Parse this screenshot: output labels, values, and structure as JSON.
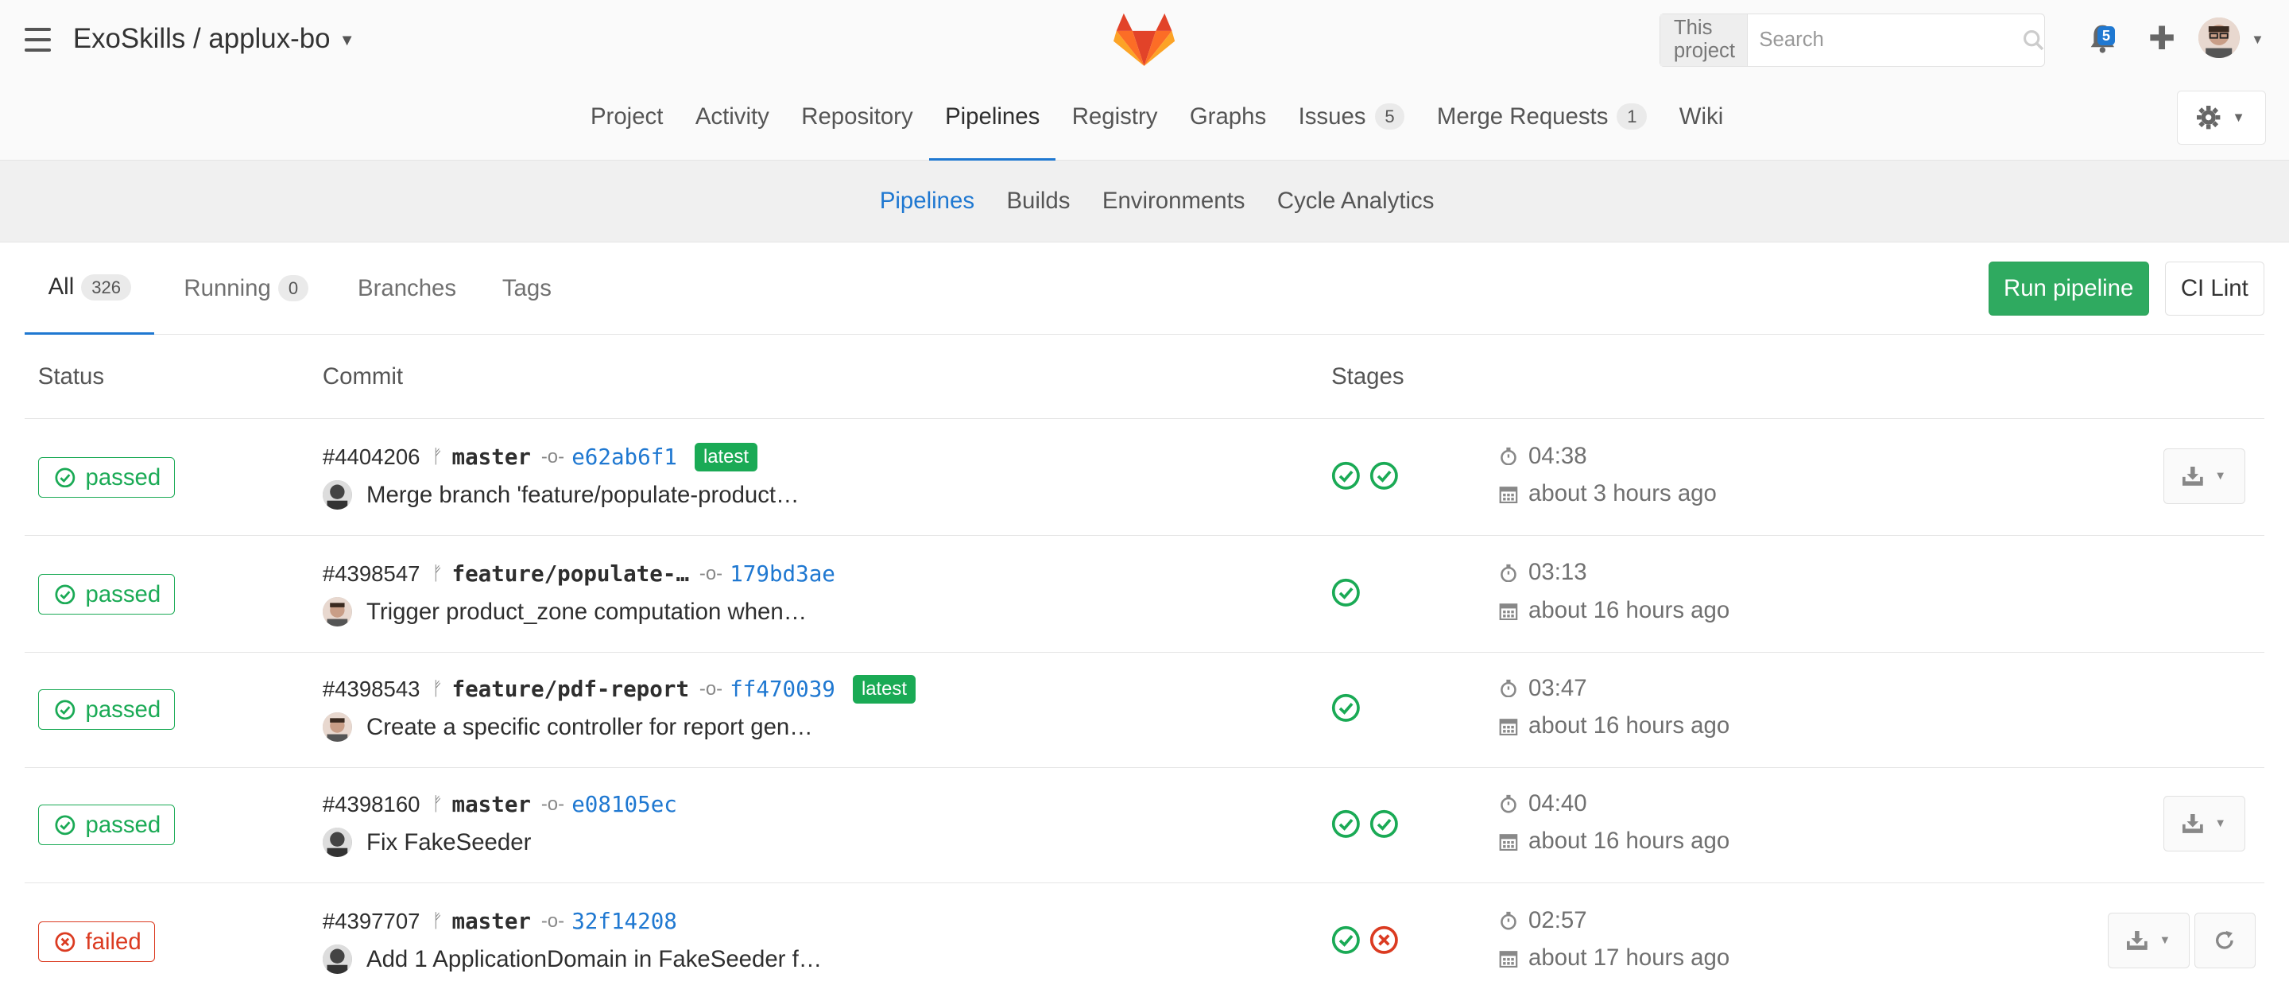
{
  "header": {
    "project_title": "ExoSkills / applux-bo",
    "search_scope": "This project",
    "search_placeholder": "Search",
    "notifications_count": "5"
  },
  "nav": {
    "items": [
      {
        "label": "Project"
      },
      {
        "label": "Activity"
      },
      {
        "label": "Repository"
      },
      {
        "label": "Pipelines"
      },
      {
        "label": "Registry"
      },
      {
        "label": "Graphs"
      },
      {
        "label": "Issues",
        "count": "5"
      },
      {
        "label": "Merge Requests",
        "count": "1"
      },
      {
        "label": "Wiki"
      }
    ],
    "active": "Pipelines"
  },
  "subnav": {
    "items": [
      "Pipelines",
      "Builds",
      "Environments",
      "Cycle Analytics"
    ],
    "active": "Pipelines"
  },
  "tabs": {
    "all": {
      "label": "All",
      "count": "326"
    },
    "running": {
      "label": "Running",
      "count": "0"
    },
    "branches": {
      "label": "Branches"
    },
    "tags": {
      "label": "Tags"
    },
    "run_pipeline": "Run pipeline",
    "ci_lint": "CI Lint"
  },
  "table": {
    "headers": {
      "status": "Status",
      "commit": "Commit",
      "stages": "Stages"
    },
    "rows": [
      {
        "status": "passed",
        "id": "#4404206",
        "branch": "master",
        "sha": "e62ab6f1",
        "latest": "latest",
        "message": "Merge branch 'feature/populate-product…",
        "stages": [
          "success",
          "success"
        ],
        "duration": "04:38",
        "finished": "about 3 hours ago"
      },
      {
        "status": "passed",
        "id": "#4398547",
        "branch": "feature/populate-…",
        "sha": "179bd3ae",
        "message": "Trigger product_zone computation when…",
        "stages": [
          "success"
        ],
        "duration": "03:13",
        "finished": "about 16 hours ago"
      },
      {
        "status": "passed",
        "id": "#4398543",
        "branch": "feature/pdf-report",
        "sha": "ff470039",
        "latest": "latest",
        "message": "Create a specific controller for report gen…",
        "stages": [
          "success"
        ],
        "duration": "03:47",
        "finished": "about 16 hours ago"
      },
      {
        "status": "passed",
        "id": "#4398160",
        "branch": "master",
        "sha": "e08105ec",
        "message": "Fix FakeSeeder",
        "stages": [
          "success",
          "success"
        ],
        "duration": "04:40",
        "finished": "about 16 hours ago"
      },
      {
        "status": "failed",
        "id": "#4397707",
        "branch": "master",
        "sha": "32f14208",
        "message": "Add 1 ApplicationDomain in FakeSeeder f…",
        "stages": [
          "success",
          "failed"
        ],
        "duration": "02:57",
        "finished": "about 17 hours ago"
      }
    ]
  },
  "colors": {
    "success": "#1aaa55",
    "failed": "#db3b21",
    "link": "#1f78d1",
    "primary_button": "#2faa60"
  }
}
